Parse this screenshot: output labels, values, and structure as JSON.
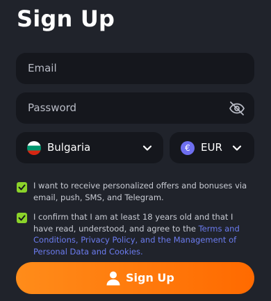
{
  "title": "Sign Up",
  "email": {
    "placeholder": "Email"
  },
  "password": {
    "placeholder": "Password"
  },
  "country": {
    "name": "Bulgaria",
    "flag_icon": "bulgaria-flag-icon"
  },
  "currency": {
    "code": "EUR",
    "symbol": "€"
  },
  "consent_offers": {
    "checked": true,
    "text": "I want to receive personalized offers and bonuses via email, push, SMS, and Telegram."
  },
  "consent_terms": {
    "checked": true,
    "text_before": "I confirm that I am at least 18 years old and that I have read, understood, and agree to the ",
    "link_terms": "Terms and Conditions",
    "text_mid": ", ",
    "link_privacy": "Privacy Policy, and the Management of Personal Data and Cookies",
    "text_after": "."
  },
  "submit": {
    "label": "Sign Up"
  },
  "colors": {
    "background": "#20232b",
    "field": "#15171d",
    "accent": "#ff7a00",
    "check": "#8bd32a",
    "link": "#6c7cf0"
  }
}
